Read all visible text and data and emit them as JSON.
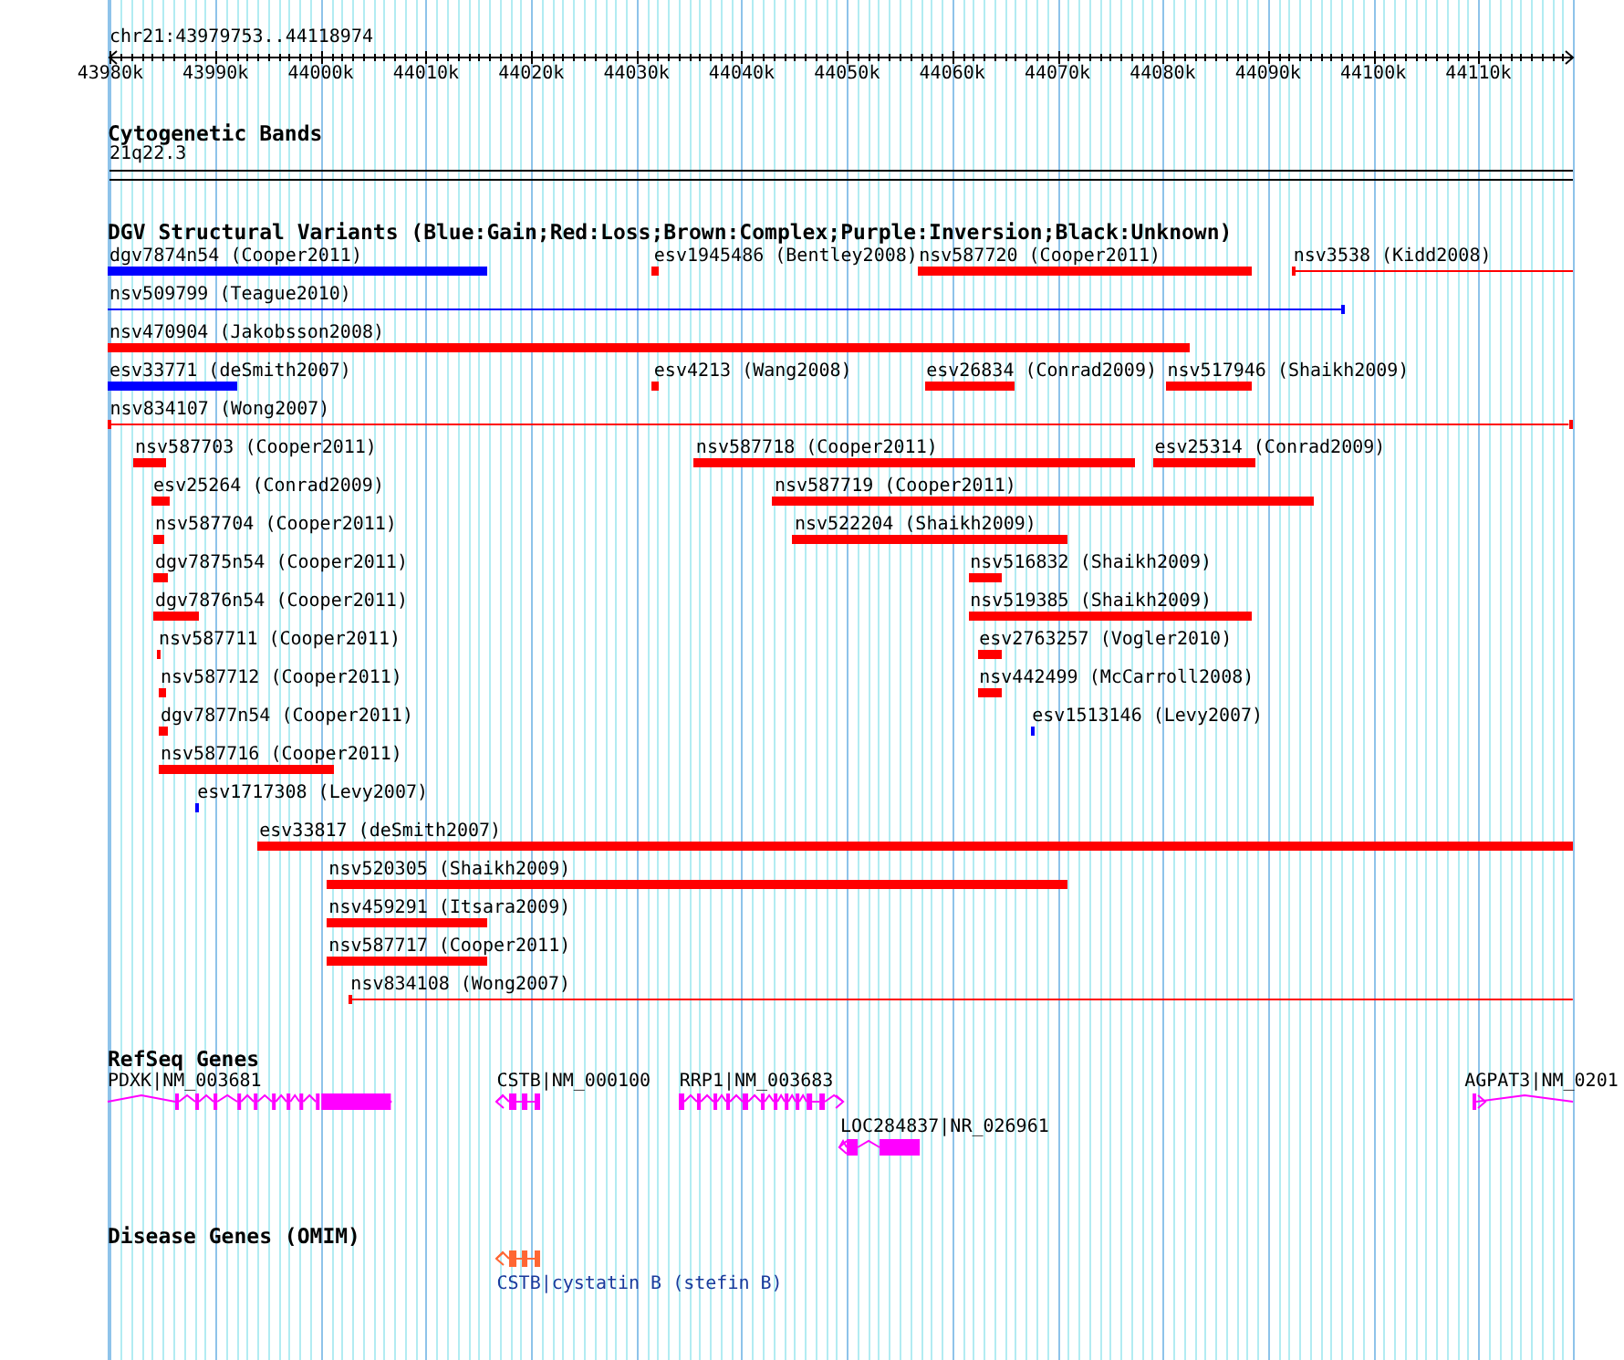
{
  "ruler": {
    "position": "chr21:43979753..44118974",
    "ticks": [
      "43980k",
      "43990k",
      "44000k",
      "44010k",
      "44020k",
      "44030k",
      "44040k",
      "44050k",
      "44060k",
      "44070k",
      "44080k",
      "44090k",
      "44100k",
      "44110k"
    ]
  },
  "tracks": [
    {
      "kind": "cytoband",
      "title": "Cytogenetic Bands",
      "band": "21q22.3"
    },
    {
      "kind": "variants",
      "title": "DGV Structural Variants (Blue:Gain;Red:Loss;Brown:Complex;Purple:Inversion;Black:Unknown)",
      "rows": [
        [
          {
            "label": "dgv7874n54 (Cooper2011)",
            "color": "#0000ff",
            "kind": "bar"
          },
          {
            "label": "esv1945486 (Bentley2008)",
            "color": "#ff0000",
            "kind": "bar"
          },
          {
            "label": "nsv587720 (Cooper2011)",
            "color": "#ff0000",
            "kind": "bar"
          },
          {
            "label": "nsv3538 (Kidd2008)",
            "color": "#ff0000",
            "kind": "line"
          }
        ],
        [
          {
            "label": "nsv509799 (Teague2010)",
            "color": "#0000ff",
            "kind": "line"
          }
        ],
        [
          {
            "label": "nsv470904 (Jakobsson2008)",
            "color": "#ff0000",
            "kind": "bar"
          }
        ],
        [
          {
            "label": "esv33771 (deSmith2007)",
            "color": "#0000ff",
            "kind": "bar"
          },
          {
            "label": "esv4213 (Wang2008)",
            "color": "#ff0000",
            "kind": "bar"
          },
          {
            "label": "esv26834 (Conrad2009)",
            "color": "#ff0000",
            "kind": "bar"
          },
          {
            "label": "nsv517946 (Shaikh2009)",
            "color": "#ff0000",
            "kind": "bar"
          }
        ],
        [
          {
            "label": "nsv834107 (Wong2007)",
            "color": "#ff0000",
            "kind": "line"
          }
        ],
        [
          {
            "label": "nsv587703 (Cooper2011)",
            "color": "#ff0000",
            "kind": "bar"
          },
          {
            "label": "nsv587718 (Cooper2011)",
            "color": "#ff0000",
            "kind": "bar"
          },
          {
            "label": "esv25314 (Conrad2009)",
            "color": "#ff0000",
            "kind": "bar"
          }
        ],
        [
          {
            "label": "esv25264 (Conrad2009)",
            "color": "#ff0000",
            "kind": "bar"
          },
          {
            "label": "nsv587719 (Cooper2011)",
            "color": "#ff0000",
            "kind": "bar"
          }
        ],
        [
          {
            "label": "nsv587704 (Cooper2011)",
            "color": "#ff0000",
            "kind": "bar"
          },
          {
            "label": "nsv522204 (Shaikh2009)",
            "color": "#ff0000",
            "kind": "bar"
          }
        ],
        [
          {
            "label": "dgv7875n54 (Cooper2011)",
            "color": "#ff0000",
            "kind": "bar"
          },
          {
            "label": "nsv516832 (Shaikh2009)",
            "color": "#ff0000",
            "kind": "bar"
          }
        ],
        [
          {
            "label": "dgv7876n54 (Cooper2011)",
            "color": "#ff0000",
            "kind": "bar"
          },
          {
            "label": "nsv519385 (Shaikh2009)",
            "color": "#ff0000",
            "kind": "bar"
          }
        ],
        [
          {
            "label": "nsv587711 (Cooper2011)",
            "color": "#ff0000",
            "kind": "bar"
          },
          {
            "label": "esv2763257 (Vogler2010)",
            "color": "#ff0000",
            "kind": "bar"
          }
        ],
        [
          {
            "label": "nsv587712 (Cooper2011)",
            "color": "#ff0000",
            "kind": "bar"
          },
          {
            "label": "nsv442499 (McCarroll2008)",
            "color": "#ff0000",
            "kind": "bar"
          }
        ],
        [
          {
            "label": "dgv7877n54 (Cooper2011)",
            "color": "#ff0000",
            "kind": "bar"
          },
          {
            "label": "esv1513146 (Levy2007)",
            "color": "#0000ff",
            "kind": "bar"
          }
        ],
        [
          {
            "label": "nsv587716 (Cooper2011)",
            "color": "#ff0000",
            "kind": "bar"
          }
        ],
        [
          {
            "label": "esv1717308 (Levy2007)",
            "color": "#0000ff",
            "kind": "bar"
          }
        ],
        [
          {
            "label": "esv33817 (deSmith2007)",
            "color": "#ff0000",
            "kind": "bar"
          }
        ],
        [
          {
            "label": "nsv520305 (Shaikh2009)",
            "color": "#ff0000",
            "kind": "bar"
          }
        ],
        [
          {
            "label": "nsv459291 (Itsara2009)",
            "color": "#ff0000",
            "kind": "bar"
          }
        ],
        [
          {
            "label": "nsv587717 (Cooper2011)",
            "color": "#ff0000",
            "kind": "bar"
          }
        ],
        [
          {
            "label": "nsv834108 (Wong2007)",
            "color": "#ff0000",
            "kind": "line"
          }
        ]
      ]
    },
    {
      "kind": "refseq",
      "title": "RefSeq Genes",
      "rows": [
        [
          {
            "label": "PDXK|NM_003681"
          },
          {
            "label": "CSTB|NM_000100"
          },
          {
            "label": "RRP1|NM_003683"
          },
          {
            "label": "AGPAT3|NM_0201"
          }
        ],
        [
          {
            "label": "LOC284837|NR_026961"
          }
        ]
      ]
    },
    {
      "kind": "omim",
      "title": "Disease Genes (OMIM)",
      "rows": [
        [
          {
            "label": "CSTB|cystatin B (stefin B)"
          }
        ]
      ]
    }
  ]
}
